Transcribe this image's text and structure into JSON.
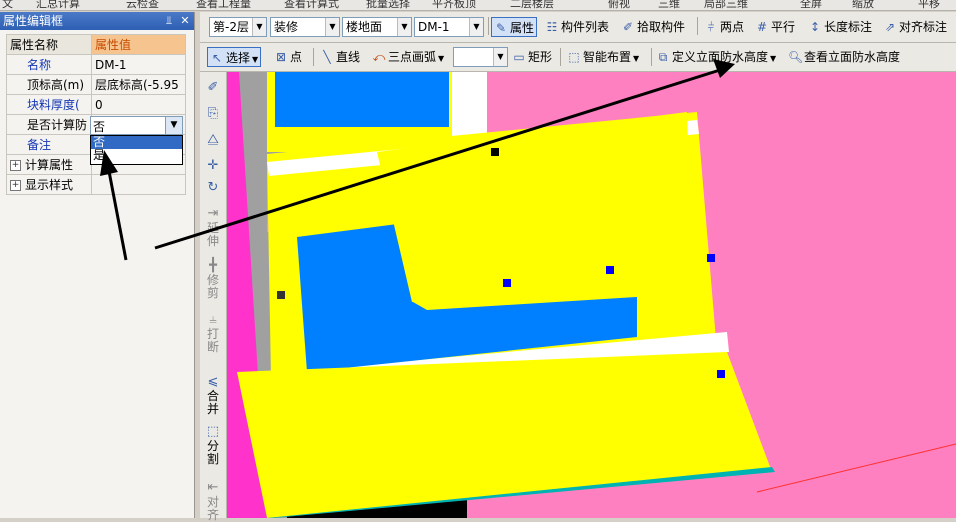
{
  "top_fragments": [
    "文",
    "汇总计算",
    "云检查",
    "查看工程量",
    "查看计算式",
    "批量选择",
    "平齐板顶",
    "二层楼层",
    "俯视",
    "三维",
    "局部三维",
    "全屏",
    "缩放",
    "平移"
  ],
  "panel": {
    "title": "属性编辑框",
    "pin_icon": "pin-icon",
    "close_icon": "close-icon",
    "col_name": "属性名称",
    "col_value": "属性值",
    "rows": [
      {
        "name": "名称",
        "value": "DM-1",
        "blue": true
      },
      {
        "name": "顶标高(m)",
        "value": "层底标高(-5.95",
        "blue": false
      },
      {
        "name": "块料厚度(",
        "value": "0",
        "blue": true
      },
      {
        "name": "是否计算防",
        "value": "否",
        "blue": false
      },
      {
        "name": "备注",
        "value": "",
        "blue": true
      },
      {
        "name": "计算属性",
        "value": "",
        "expand": true
      },
      {
        "name": "显示样式",
        "value": "",
        "expand": true
      }
    ],
    "dropdown_options": [
      "否",
      "是"
    ],
    "dropdown_selected": "否"
  },
  "toolbar1": {
    "floor": "第-2层",
    "category": "装修",
    "type": "楼地面",
    "component": "DM-1",
    "attributes": "属性",
    "component_list": "构件列表",
    "pick_component": "拾取构件",
    "two_points": "两点",
    "parallel": "平行",
    "length_dim": "长度标注",
    "align_dim": "对齐标注"
  },
  "toolbar2": {
    "select": "选择",
    "point": "点",
    "line": "直线",
    "three_point_arc": "三点画弧",
    "rectangle": "矩形",
    "smart_layout": "智能布置",
    "define_wall_height": "定义立面防水高度",
    "view_wall_height": "查看立面防水高度"
  },
  "vbar": {
    "extend": "延伸",
    "trim": "修剪",
    "break": "打断",
    "merge": "合并",
    "split": "分割",
    "align": "对齐"
  },
  "colors": {
    "yellow": "#ffff00",
    "blue": "#0080ff",
    "magenta": "#ff80c0",
    "pink": "#ff66cc",
    "gray": "#a0a0a0",
    "white": "#ffffff",
    "cyan_edge": "#00b3b3"
  }
}
